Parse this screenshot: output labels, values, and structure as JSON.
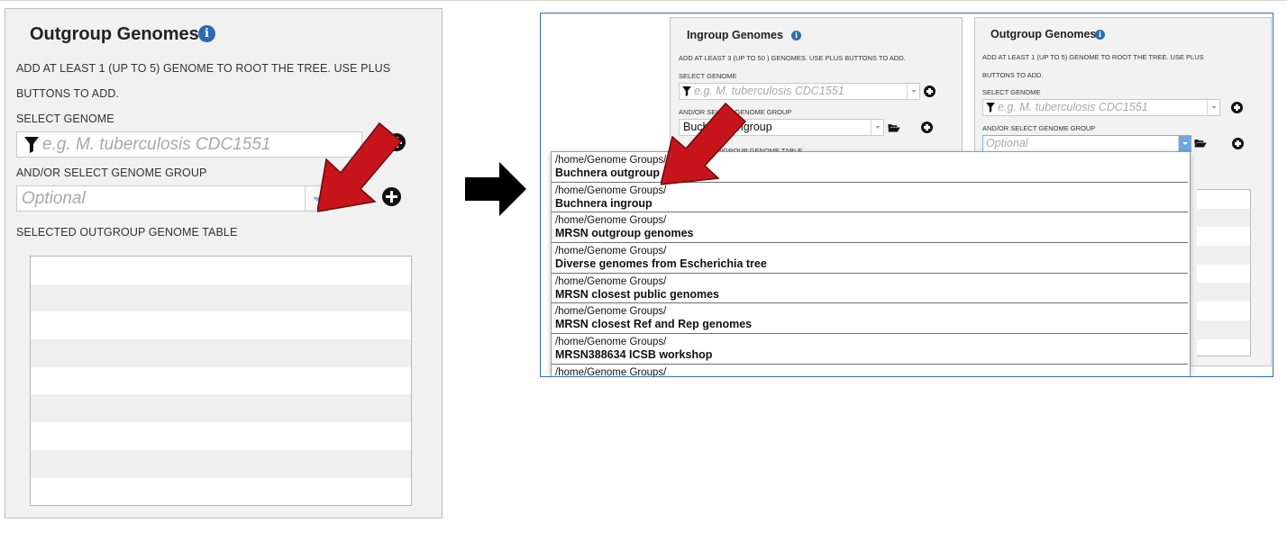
{
  "left_panel": {
    "title": "Outgroup Genomes",
    "instructions_line1": "ADD AT LEAST 1 (UP TO 5) GENOME TO ROOT THE TREE. USE PLUS",
    "instructions_line2": "BUTTONS TO ADD.",
    "select_genome_label": "SELECT GENOME",
    "genome_placeholder": "e.g. M. tuberculosis CDC1551",
    "select_group_label": "AND/OR SELECT GENOME GROUP",
    "group_placeholder": "Optional",
    "table_label": "SELECTED OUTGROUP GENOME TABLE",
    "table_rows": 9
  },
  "right_screenshot": {
    "ingroup": {
      "title": "Ingroup Genomes",
      "instructions": "ADD AT LEAST 3 (UP TO 50 ) GENOMES. USE PLUS BUTTONS TO ADD.",
      "select_genome_label": "SELECT GENOME",
      "genome_placeholder": "e.g. M. tuberculosis CDC1551",
      "select_group_label": "AND/OR SELECT GENOME GROUP",
      "group_value": "Buchnera ingroup",
      "table_label_partial": "SELECTED INGROUP GENOME TABLE"
    },
    "outgroup": {
      "title": "Outgroup Genomes",
      "instructions_line1": "ADD AT LEAST 1 (UP TO 5) GENOME TO ROOT THE TREE. USE PLUS",
      "instructions_line2": "BUTTONS TO ADD.",
      "select_genome_label": "SELECT GENOME",
      "genome_placeholder": "e.g. M. tuberculosis CDC1551",
      "select_group_label": "AND/OR SELECT GENOME GROUP",
      "group_placeholder": "Optional"
    },
    "dropdown_items": [
      {
        "path": "/home/Genome Groups/",
        "name": "Buchnera outgroup"
      },
      {
        "path": "/home/Genome Groups/",
        "name": "Buchnera ingroup"
      },
      {
        "path": "/home/Genome Groups/",
        "name": "MRSN outgroup genomes"
      },
      {
        "path": "/home/Genome Groups/",
        "name": "Diverse genomes from Escherichia tree"
      },
      {
        "path": "/home/Genome Groups/",
        "name": "MRSN closest public genomes"
      },
      {
        "path": "/home/Genome Groups/",
        "name": "MRSN closest Ref and Rep genomes"
      },
      {
        "path": "/home/Genome Groups/",
        "name": "MRSN388634 ICSB workshop"
      },
      {
        "path": "/home/Genome Groups/",
        "name": ""
      }
    ]
  },
  "icons": {
    "info": "info-icon",
    "filter": "funnel-icon",
    "folder": "folder-open-icon",
    "add": "plus-circle-icon",
    "pointer_left": "red-arrow",
    "pointer_right": "red-arrow",
    "transition": "black-right-arrow"
  },
  "colors": {
    "info_blue": "#2a6cb2",
    "pointer_red": "#c8141b",
    "frame_blue": "#2f6fb6",
    "dropdown_active": "#6fa8e0"
  }
}
